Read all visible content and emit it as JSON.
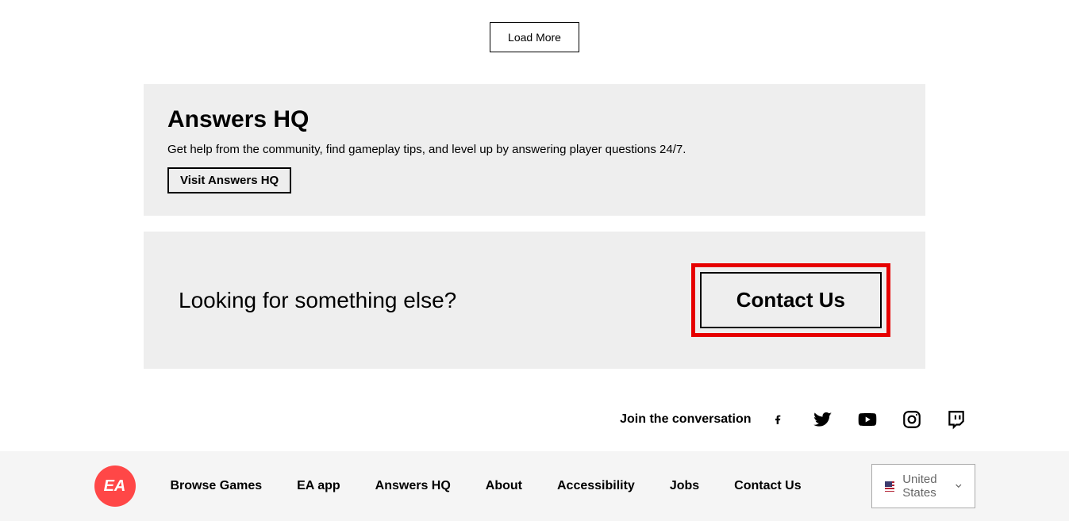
{
  "load_more": "Load More",
  "answers": {
    "title": "Answers HQ",
    "desc": "Get help from the community, find gameplay tips, and level up by answering player questions 24/7.",
    "button": "Visit Answers HQ"
  },
  "contact": {
    "title": "Looking for something else?",
    "button": "Contact Us"
  },
  "social": {
    "join": "Join the conversation"
  },
  "footer": {
    "logo": "EA",
    "links": [
      "Browse Games",
      "EA app",
      "Answers HQ",
      "About",
      "Accessibility",
      "Jobs",
      "Contact Us"
    ],
    "region": "United States"
  }
}
